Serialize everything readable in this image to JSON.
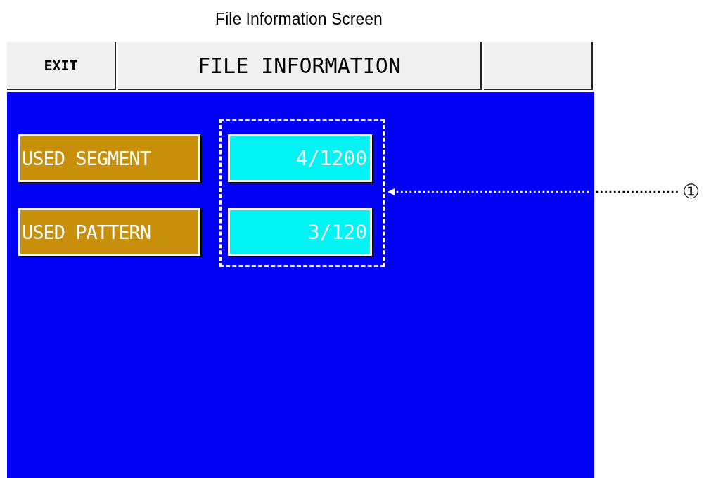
{
  "caption": "File Information Screen",
  "header": {
    "exit_button": "EXIT",
    "title": "FILE INFORMATION"
  },
  "fields": [
    {
      "label": "USED SEGMENT",
      "value": "4/1200"
    },
    {
      "label": "USED PATTERN",
      "value": "3/120"
    }
  ],
  "callout": "①"
}
